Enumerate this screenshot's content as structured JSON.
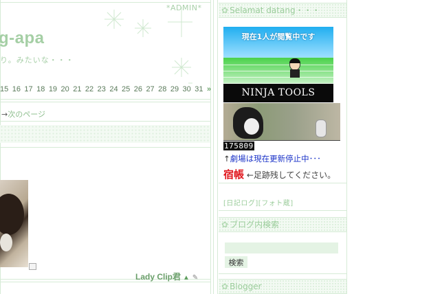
{
  "main": {
    "admin_link": "*ADMIN*",
    "blog_title": "g-apa",
    "blog_description": "り。みたいな・・・",
    "calendar_days": [
      "15",
      "16",
      "17",
      "18",
      "19",
      "20",
      "21",
      "22",
      "23",
      "24",
      "25",
      "26",
      "27",
      "28",
      "29",
      "30",
      "31"
    ],
    "calendar_next": "»",
    "next_page_arrow": "→",
    "next_page_label": "次のページ",
    "post_author": "Lady Clip君",
    "up_icon": "▲",
    "pin_icon": "✎"
  },
  "sidebar": {
    "welcome_header": "Selamat datang・・・",
    "ninja_caption": "現在1人が閲覧中です",
    "ninja_brand": "NINJA TOOLS",
    "counter": "175809",
    "theater_arrow": "↑",
    "theater_text": "劇場は現在更新停止中･･･",
    "guestbook_title": "宿帳",
    "guestbook_text": "←足跡残してください。",
    "log_links": "[日記ログ][フォト蔵]",
    "search_header": "ブログ内検索",
    "search_button": "検索",
    "search_value": "",
    "blogger_header": "Blogger"
  },
  "colors": {
    "accent_green": "#9ccd9c",
    "link_blue": "#1b33c8",
    "guestbook_red": "#e0161d"
  },
  "icons": [
    "sparkle-icon",
    "flower-icon",
    "up-arrow-icon",
    "pin-icon",
    "resize-icon"
  ]
}
